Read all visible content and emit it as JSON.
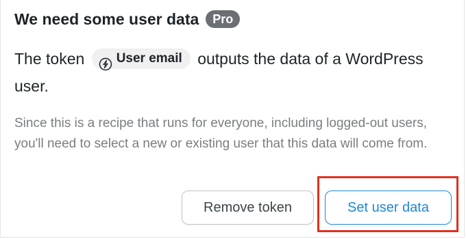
{
  "dialog": {
    "title": "We need some user data",
    "badge": "Pro",
    "message_prefix": "The token",
    "token_label": "User email",
    "message_suffix": "outputs the data of a WordPress user.",
    "description": "Since this is a recipe that runs for everyone, including logged-out users, you'll need to select a new or existing user that this data will come from.",
    "remove_button_label": "Remove token",
    "set_button_label": "Set user data",
    "token_icon": "bolt-circle-icon"
  },
  "colors": {
    "badge_bg": "#6b6f73",
    "primary": "#1e87d6",
    "highlight": "#e0301e",
    "muted_text": "#7a7d80"
  }
}
